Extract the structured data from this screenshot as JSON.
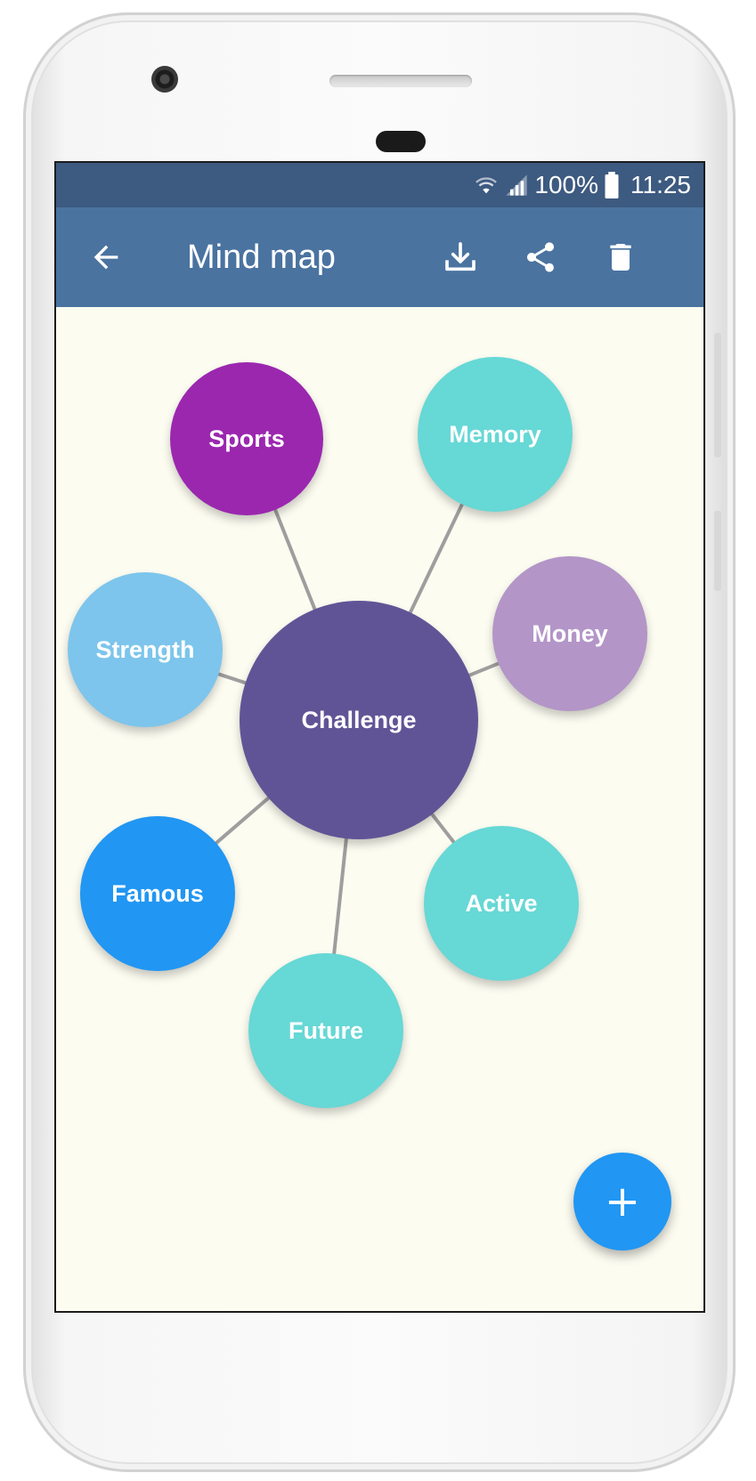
{
  "status_bar": {
    "battery_percent": "100%",
    "time": "11:25",
    "icons": [
      "wifi-icon",
      "signal-icon",
      "battery-icon"
    ]
  },
  "app_bar": {
    "title": "Mind map",
    "actions": [
      "back-arrow-icon",
      "download-icon",
      "share-icon",
      "delete-icon"
    ]
  },
  "mind_map": {
    "center": {
      "label": "Challenge",
      "color": "#615496"
    },
    "nodes": [
      {
        "label": "Sports",
        "color": "#9b27af"
      },
      {
        "label": "Memory",
        "color": "#66d8d6"
      },
      {
        "label": "Money",
        "color": "#b395c7"
      },
      {
        "label": "Strength",
        "color": "#7dc5ec"
      },
      {
        "label": "Famous",
        "color": "#2196f3"
      },
      {
        "label": "Active",
        "color": "#66d8d6"
      },
      {
        "label": "Future",
        "color": "#66d8d6"
      }
    ]
  },
  "fab": {
    "icon": "plus-icon",
    "glyph": "+",
    "color": "#2196f3"
  },
  "colors": {
    "status_bar": "#3d5a80",
    "app_bar": "#4a73a0",
    "canvas_background": "#fcfcf1",
    "link_line": "#9e9e9e"
  }
}
